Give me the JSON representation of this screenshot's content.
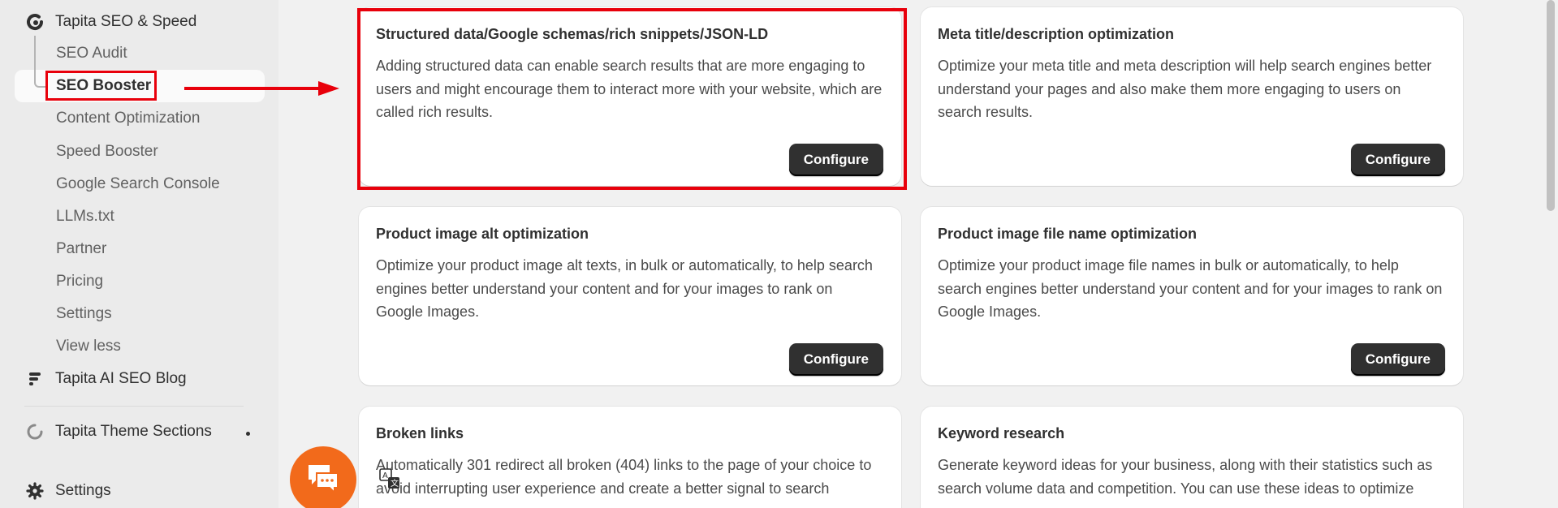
{
  "sidebar": {
    "app_name": "Tapita SEO & Speed",
    "sub_items": [
      {
        "label": "SEO Audit"
      },
      {
        "label": "SEO Booster"
      },
      {
        "label": "Content Optimization"
      },
      {
        "label": "Speed Booster"
      },
      {
        "label": "Google Search Console"
      },
      {
        "label": "LLMs.txt"
      },
      {
        "label": "Partner"
      },
      {
        "label": "Pricing"
      },
      {
        "label": "Settings"
      },
      {
        "label": "View less"
      }
    ],
    "blog_app": "Tapita AI SEO Blog",
    "theme_app": "Tapita Theme Sections",
    "settings": "Settings"
  },
  "cards": [
    {
      "title": "Structured data/Google schemas/rich snippets/JSON-LD",
      "description": "Adding structured data can enable search results that are more engaging to users and might encourage them to interact more with your website, which are called rich results.",
      "button": "Configure"
    },
    {
      "title": "Meta title/description optimization",
      "description": "Optimize your meta title and meta description will help search engines better understand your pages and also make them more engaging to users on search results.",
      "button": "Configure"
    },
    {
      "title": "Product image alt optimization",
      "description": "Optimize your product image alt texts, in bulk or automatically, to help search engines better understand your content and for your images to rank on Google Images.",
      "button": "Configure"
    },
    {
      "title": "Product image file name optimization",
      "description": "Optimize your product image file names in bulk or automatically, to help search engines better understand your content and for your images to rank on Google Images.",
      "button": "Configure"
    },
    {
      "title": "Broken links",
      "description": "Automatically 301 redirect all broken (404) links to the page of your choice to avoid interrupting user experience and create a better signal to search"
    },
    {
      "title": "Keyword research",
      "description": "Generate keyword ideas for your business, along with their statistics such as search volume data and competition. You can use these ideas to optimize"
    }
  ],
  "colors": {
    "highlight": "#e8000b",
    "chat": "#f26a1b",
    "button": "#303030"
  },
  "icons": {
    "app": "tapita-g-icon",
    "blog": "blog-lines-icon",
    "theme": "spinner-icon",
    "settings": "gear-icon",
    "chat": "chat-icon",
    "translate": "translate-icon"
  }
}
